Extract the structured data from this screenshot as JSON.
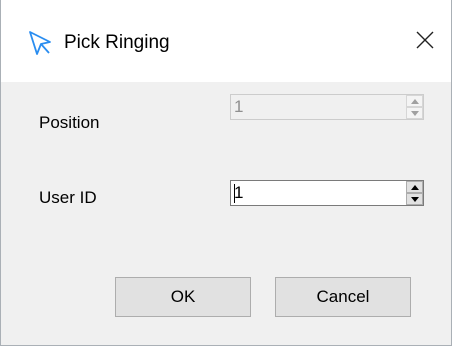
{
  "window": {
    "title": "Pick Ringing",
    "title_icon": "pointer-arrow-icon",
    "close_icon": "close-icon"
  },
  "form": {
    "position": {
      "label": "Position",
      "value": "1",
      "enabled": false
    },
    "user_id": {
      "label": "User ID",
      "value": "1",
      "enabled": true
    }
  },
  "buttons": {
    "ok_label": "OK",
    "cancel_label": "Cancel"
  },
  "colors": {
    "client_background": "#f0f0f0",
    "titlebar_background": "#ffffff",
    "icon_accent": "#1e90ff"
  }
}
